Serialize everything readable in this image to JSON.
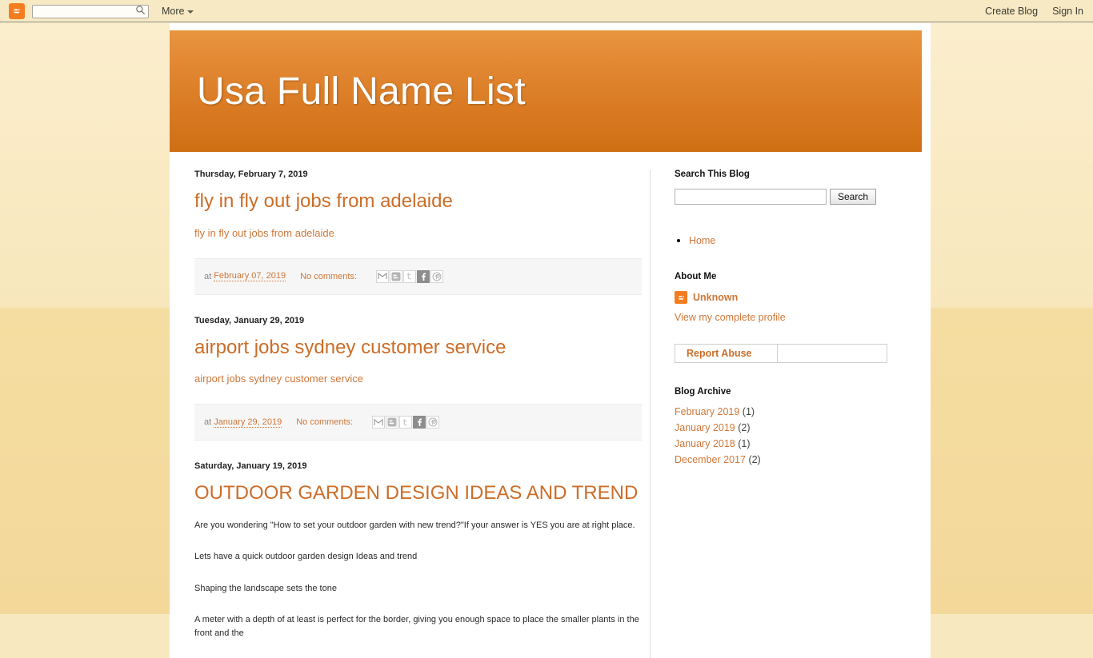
{
  "navbar": {
    "logo_icon": "blogger-icon",
    "search_placeholder": "",
    "search_value": "",
    "search_icon": "search-icon",
    "more_label": "More",
    "create_blog_label": "Create Blog",
    "sign_in_label": "Sign In"
  },
  "header": {
    "blog_title": "Usa Full Name List",
    "accent_color": "#d8791f"
  },
  "posts": [
    {
      "date_header": "Thursday, February 7, 2019",
      "title": "fly in fly out jobs from adelaide",
      "body_link": "fly in fly out jobs from adelaide",
      "footer": {
        "at_label": "at",
        "timestamp": "February 07, 2019",
        "comments": "No comments:"
      }
    },
    {
      "date_header": "Tuesday, January 29, 2019",
      "title": "airport jobs sydney customer service",
      "body_link": "airport jobs sydney customer service",
      "footer": {
        "at_label": "at",
        "timestamp": "January 29, 2019",
        "comments": "No comments:"
      }
    },
    {
      "date_header": "Saturday, January 19, 2019",
      "title": "OUTDOOR GARDEN DESIGN IDEAS AND TREND",
      "paragraphs": [
        "Are you wondering \"How to set your outdoor garden with new trend?\"If your answer is YES you are at right place.",
        "Lets have a quick outdoor garden design Ideas and trend",
        "Shaping the landscape sets the tone",
        "A meter with a depth of at least is perfect for the border, giving you enough space to place the smaller plants in the front and the"
      ]
    }
  ],
  "share_icons": [
    {
      "name": "email-share-icon",
      "label": "M"
    },
    {
      "name": "blogger-share-icon",
      "label": "B"
    },
    {
      "name": "twitter-share-icon",
      "label": "t"
    },
    {
      "name": "facebook-share-icon",
      "label": "f"
    },
    {
      "name": "pinterest-share-icon",
      "label": "P"
    }
  ],
  "sidebar": {
    "search_heading": "Search This Blog",
    "search_value": "",
    "search_placeholder": "",
    "search_button": "Search",
    "pages": [
      {
        "label": "Home"
      }
    ],
    "about_heading": "About Me",
    "profile_name": "Unknown",
    "profile_icon": "blogger-icon",
    "profile_link": "View my complete profile",
    "report_abuse": "Report Abuse",
    "archive_heading": "Blog Archive",
    "archive": [
      {
        "label": "February 2019",
        "count": "(1)"
      },
      {
        "label": "January 2019",
        "count": "(2)"
      },
      {
        "label": "January 2018",
        "count": "(1)"
      },
      {
        "label": "December 2017",
        "count": "(2)"
      }
    ]
  }
}
